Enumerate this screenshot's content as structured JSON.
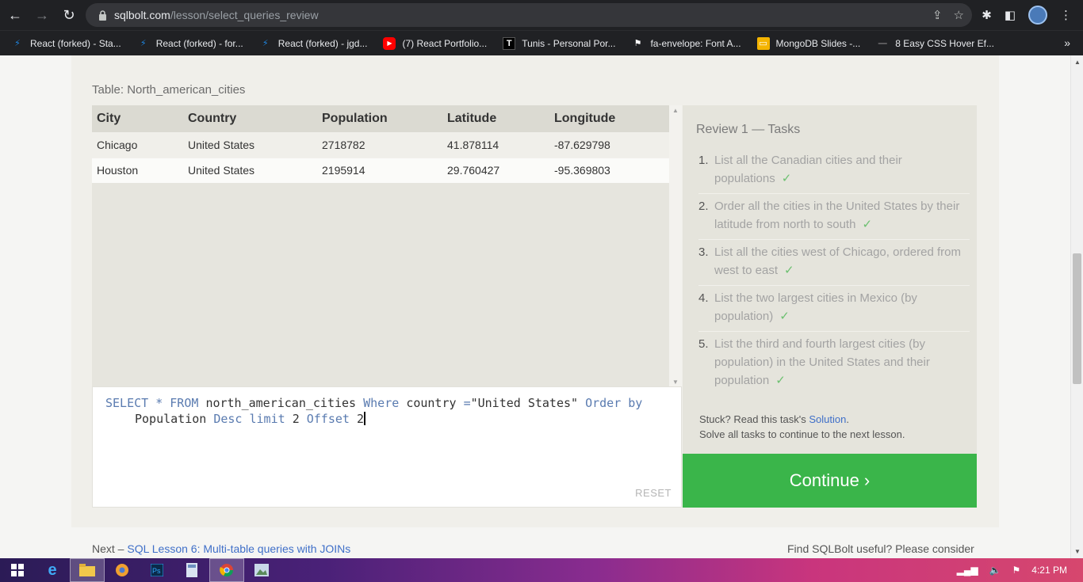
{
  "browser": {
    "url_host": "sqlbolt.com",
    "url_path": "/lesson/select_queries_review",
    "bookmarks": [
      {
        "label": "React (forked) - Sta...",
        "icon": "bolt-icon",
        "color": "#1e88e5"
      },
      {
        "label": "React (forked) - for...",
        "icon": "bolt-icon",
        "color": "#1e88e5"
      },
      {
        "label": "React (forked) - jgd...",
        "icon": "bolt-icon",
        "color": "#1e88e5"
      },
      {
        "label": "(7) React Portfolio...",
        "icon": "youtube-icon",
        "color": "#ff0000"
      },
      {
        "label": "Tunis - Personal Por...",
        "icon": "t-logo-icon",
        "color": "#000000"
      },
      {
        "label": "fa-envelope: Font A...",
        "icon": "flag-icon",
        "color": "#ffffff"
      },
      {
        "label": "MongoDB Slides -...",
        "icon": "slides-icon",
        "color": "#f4b400"
      },
      {
        "label": "8 Easy CSS Hover Ef...",
        "icon": "dash-icon",
        "color": "#888888"
      }
    ],
    "more_label": "»"
  },
  "lesson": {
    "table_title": "Table: North_american_cities",
    "columns": [
      "City",
      "Country",
      "Population",
      "Latitude",
      "Longitude"
    ],
    "rows": [
      [
        "Chicago",
        "United States",
        "2718782",
        "41.878114",
        "-87.629798"
      ],
      [
        "Houston",
        "United States",
        "2195914",
        "29.760427",
        "-95.369803"
      ]
    ],
    "query": {
      "line1": [
        {
          "t": "SELECT * FROM ",
          "c": "kw"
        },
        {
          "t": "north_american_cities ",
          "c": "plain"
        },
        {
          "t": "Where ",
          "c": "kw"
        },
        {
          "t": "country ",
          "c": "plain"
        },
        {
          "t": "=",
          "c": "kw"
        },
        {
          "t": "\"United States\" ",
          "c": "plain"
        },
        {
          "t": "Order by",
          "c": "kw"
        }
      ],
      "line2": [
        {
          "t": "Population ",
          "c": "plain"
        },
        {
          "t": "Desc limit ",
          "c": "kw"
        },
        {
          "t": "2 ",
          "c": "plain"
        },
        {
          "t": "Offset ",
          "c": "kw"
        },
        {
          "t": "2",
          "c": "plain"
        }
      ]
    },
    "reset_label": "RESET",
    "tasks_title": "Review 1 — Tasks",
    "tasks": [
      {
        "num": "1.",
        "text": "List all the Canadian cities and their populations",
        "done": true
      },
      {
        "num": "2.",
        "text": "Order all the cities in the United States by their latitude from north to south",
        "done": true
      },
      {
        "num": "3.",
        "text": "List all the cities west of Chicago, ordered from west to east",
        "done": true
      },
      {
        "num": "4.",
        "text": "List the two largest cities in Mexico (by population)",
        "done": true
      },
      {
        "num": "5.",
        "text": "List the third and fourth largest cities (by population) in the United States and their population",
        "done": true
      }
    ],
    "check_mark": "✓",
    "stuck_prefix": "Stuck? Read this task's ",
    "solution_link": "Solution",
    "stuck_suffix": ".",
    "solve_all": "Solve all tasks to continue to the next lesson.",
    "continue_label": "Continue ›",
    "next_prefix": "Next – ",
    "next_link": "SQL Lesson 6: Multi-table queries with JOINs",
    "footer_right": "Find SQLBolt useful? Please consider"
  },
  "taskbar": {
    "clock": "4:21 PM"
  },
  "colors": {
    "accent_green": "#3ab54a",
    "link_blue": "#3f6fc8",
    "keyword_blue": "#5a7bb0"
  }
}
